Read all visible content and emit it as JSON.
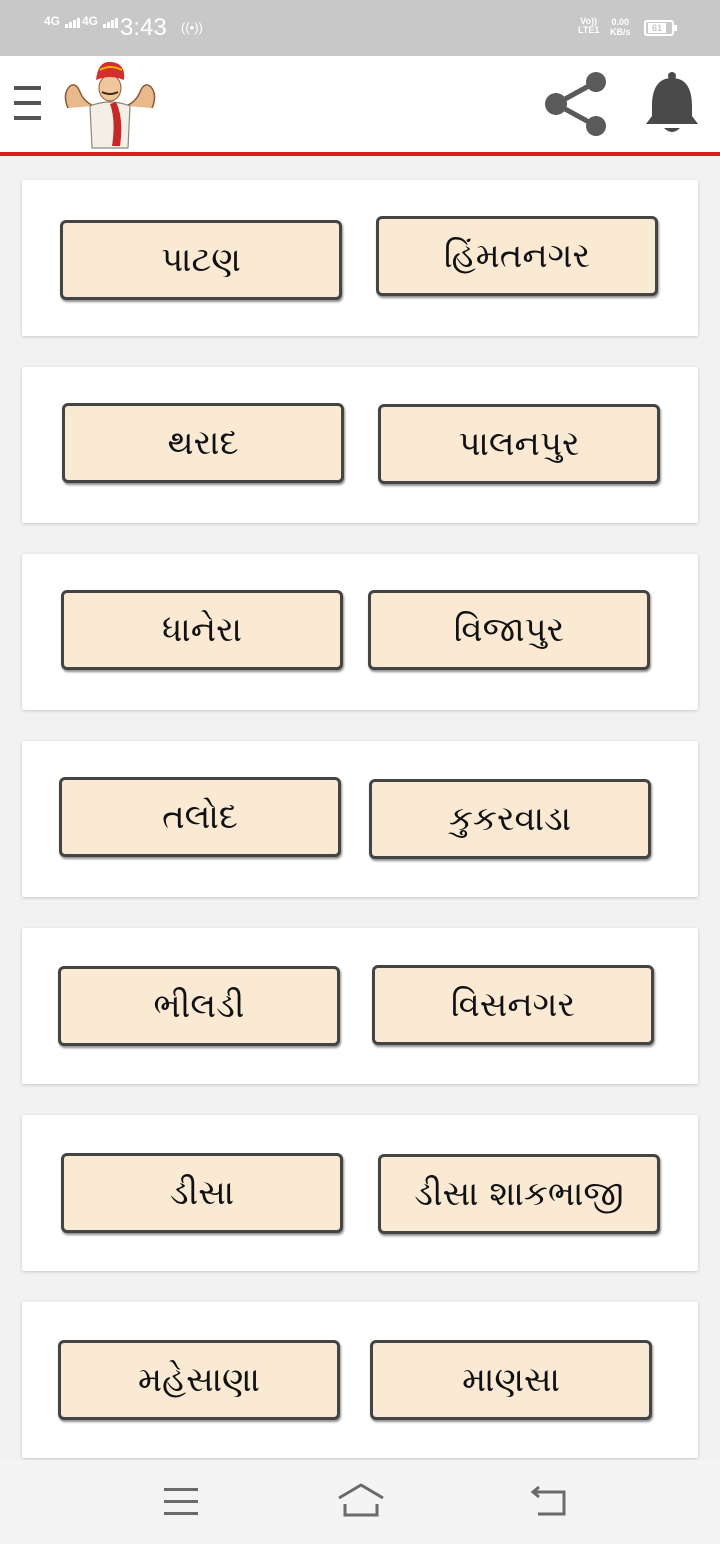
{
  "status_bar": {
    "sim1": "4G",
    "sim2": "4G",
    "time": "3:43",
    "hotspot": "((•))",
    "volte_top": "Vo))",
    "volte_bottom": "LTE1",
    "speed_value": "0.00",
    "speed_unit": "KB/s",
    "battery": "61"
  },
  "app_bar": {
    "menu_icon": "hamburger-icon",
    "logo": "logo-strongman-turban",
    "share_icon": "share-icon",
    "bell_icon": "bell-icon",
    "accent_color": "#d81c1c"
  },
  "cards": [
    {
      "left": "પાટણ",
      "right": "હિંમતનગર"
    },
    {
      "left": "થરાદ",
      "right": "પાલનપુર"
    },
    {
      "left": "ધાનેરા",
      "right": "વિજાપુર"
    },
    {
      "left": "તલોદ",
      "right": "કુકરવાડા"
    },
    {
      "left": "ભીલડી",
      "right": "વિસનગર"
    },
    {
      "left": "ડીસા",
      "right": "ડીસા શાકભાજી"
    },
    {
      "left": "મહેસાણા",
      "right": "માણસા"
    }
  ],
  "nav_bar": {
    "menu_icon": "recent-apps-icon",
    "home_icon": "home-icon",
    "back_icon": "back-icon"
  },
  "colors": {
    "button_bg": "#fae9d3",
    "button_border": "#444444"
  }
}
